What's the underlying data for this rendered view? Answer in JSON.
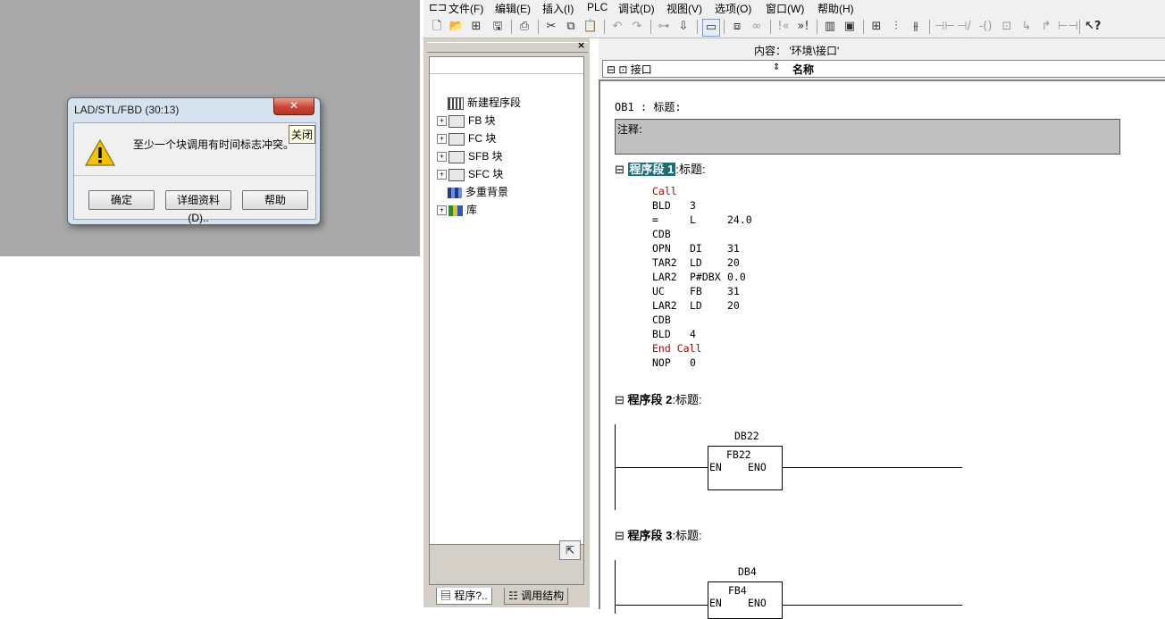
{
  "dialog": {
    "title": "LAD/STL/FBD  (30:13)",
    "close_glyph": "✕",
    "message": "至少一个块调用有时间标志冲突。",
    "tooltip": "关闭",
    "buttons": {
      "ok": "确定",
      "details": "详细资料 (D)..",
      "help": "帮助"
    }
  },
  "menubar": {
    "items": [
      "文件(F)",
      "编辑(E)",
      "插入(I)",
      "PLC",
      "调试(D)",
      "视图(V)",
      "选项(O)",
      "窗口(W)",
      "帮助(H)"
    ]
  },
  "left_panel": {
    "close": "×",
    "tree": [
      {
        "label": "新建程序段",
        "icon": "network-icon",
        "expander": false
      },
      {
        "label": "FB 块",
        "icon": "block-icon",
        "expander": true
      },
      {
        "label": "FC 块",
        "icon": "block-icon",
        "expander": true
      },
      {
        "label": "SFB 块",
        "icon": "block-icon",
        "expander": true
      },
      {
        "label": "SFC 块",
        "icon": "block-icon",
        "expander": true
      },
      {
        "label": "多重背景",
        "icon": "multi-instance-icon",
        "expander": false
      },
      {
        "label": "库",
        "icon": "library-icon",
        "expander": true
      }
    ],
    "tabs": [
      "程序?..",
      "调用结构"
    ]
  },
  "editor_header": {
    "content": "内容：  '环境\\接口'",
    "interface": "接口",
    "column_name": "名称"
  },
  "editor": {
    "ob_title": "OB1 : 标题:",
    "comment_label": "注释:",
    "network1": {
      "label": "程序段 1",
      "title": ":标题:",
      "lines": [
        {
          "op": "Call",
          "arg1": "",
          "arg2": "",
          "red": true
        },
        {
          "op": "BLD",
          "arg1": "3",
          "arg2": "",
          "red": false
        },
        {
          "op": "=",
          "arg1": "L",
          "arg2": "24.0",
          "red": false
        },
        {
          "op": "CDB",
          "arg1": "",
          "arg2": "",
          "red": false
        },
        {
          "op": "OPN",
          "arg1": "DI",
          "arg2": "31",
          "red": false
        },
        {
          "op": "TAR2",
          "arg1": "LD",
          "arg2": "20",
          "red": false
        },
        {
          "op": "LAR2",
          "arg1": "P#DBX",
          "arg2": "0.0",
          "red": false
        },
        {
          "op": "UC",
          "arg1": "FB",
          "arg2": "31",
          "red": false
        },
        {
          "op": "LAR2",
          "arg1": "LD",
          "arg2": "20",
          "red": false
        },
        {
          "op": "CDB",
          "arg1": "",
          "arg2": "",
          "red": false
        },
        {
          "op": "BLD",
          "arg1": "4",
          "arg2": "",
          "red": false
        },
        {
          "op": "End Call",
          "arg1": "",
          "arg2": "",
          "red": true
        },
        {
          "op": "NOP",
          "arg1": "0",
          "arg2": "",
          "red": false
        }
      ]
    },
    "network2": {
      "label": "程序段 2",
      "title": ":标题:",
      "db": "DB22",
      "fb": "FB22",
      "en": "EN",
      "eno": "ENO"
    },
    "network3": {
      "label": "程序段 3",
      "title": ":标题:",
      "db": "DB4",
      "fb": "FB4",
      "en": "EN",
      "eno": "ENO"
    }
  }
}
